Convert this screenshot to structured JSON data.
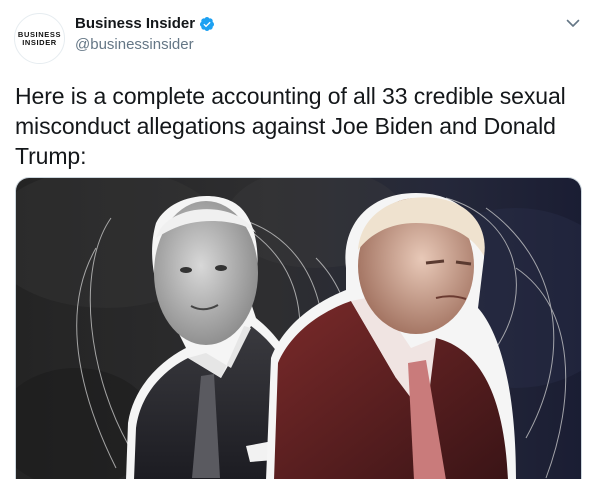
{
  "author": {
    "display_name": "Business Insider",
    "handle": "@businessinsider",
    "verified": true,
    "avatar_text_line1": "BUSINESS",
    "avatar_text_line2": "INSIDER"
  },
  "tweet": {
    "text": "Here is a complete accounting of all 33 credible sexual misconduct allegations against Joe Biden and Donald Trump:"
  },
  "icons": {
    "verified": "verified-badge-icon",
    "menu": "chevron-down-icon"
  },
  "colors": {
    "verified_blue": "#1da1f2",
    "handle_gray": "#657786"
  }
}
